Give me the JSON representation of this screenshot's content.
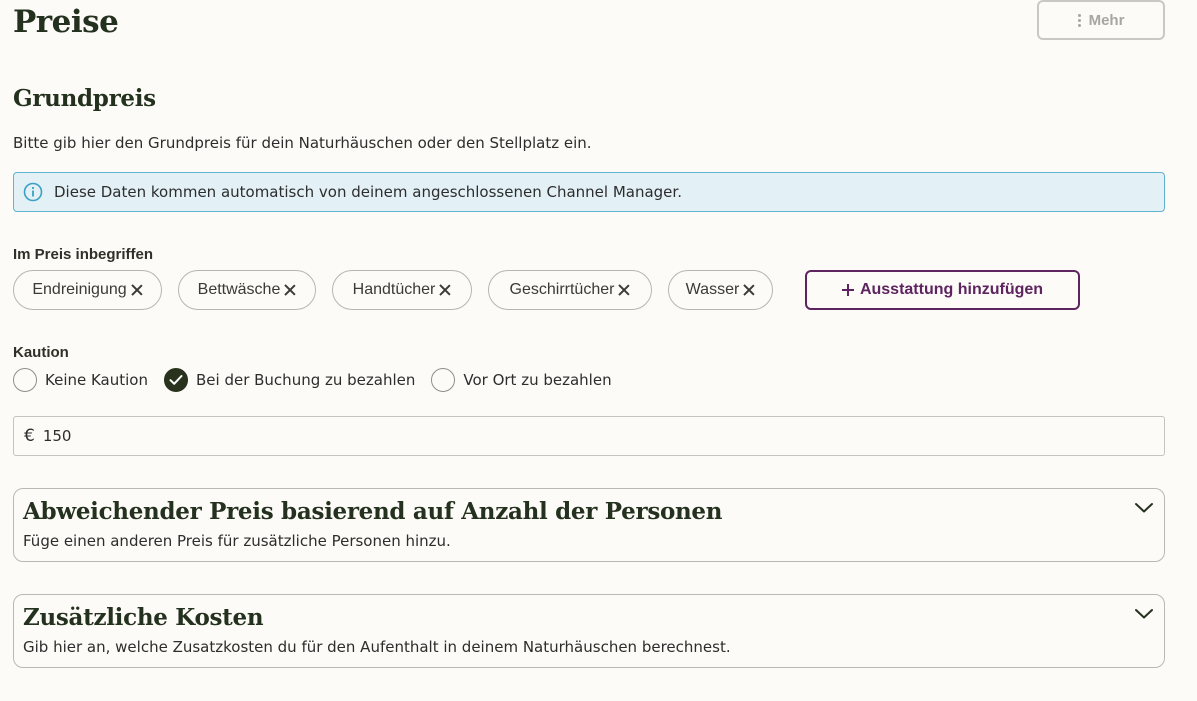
{
  "header": {
    "title": "Preise",
    "more_label": "Mehr"
  },
  "section": {
    "title": "Grundpreis",
    "description": "Bitte gib hier den Grundpreis für dein Naturhäuschen oder den Stellplatz ein."
  },
  "info_banner": {
    "icon": "info-icon",
    "text": "Diese Daten kommen automatisch von deinem angeschlossenen Channel Manager."
  },
  "included": {
    "label": "Im Preis inbegriffen",
    "chips": [
      "Endreinigung",
      "Bettwäsche",
      "Handtücher",
      "Geschirrtücher",
      "Wasser"
    ],
    "add_label": "Ausstattung hinzufügen"
  },
  "deposit": {
    "label": "Kaution",
    "options": [
      {
        "label": "Keine Kaution",
        "checked": false
      },
      {
        "label": "Bei der Buchung zu bezahlen",
        "checked": true
      },
      {
        "label": "Vor Ort zu bezahlen",
        "checked": false
      }
    ],
    "currency": "€",
    "value": "150"
  },
  "accordions": [
    {
      "title": "Abweichender Preis basierend auf Anzahl der Personen",
      "subtitle": "Füge einen anderen Preis für zusätzliche Personen hinzu."
    },
    {
      "title": "Zusätzliche Kosten",
      "subtitle": "Gib hier an, welche Zusatzkosten du für den Aufenthalt in deinem Naturhäuschen berechnest."
    }
  ],
  "colors": {
    "background": "#fcfbf7",
    "heading": "#25311f",
    "accent_purple": "#5e2460",
    "info_bg": "#e3f1f7",
    "info_border": "#5fb4cf",
    "radio_checked": "#28321d"
  }
}
